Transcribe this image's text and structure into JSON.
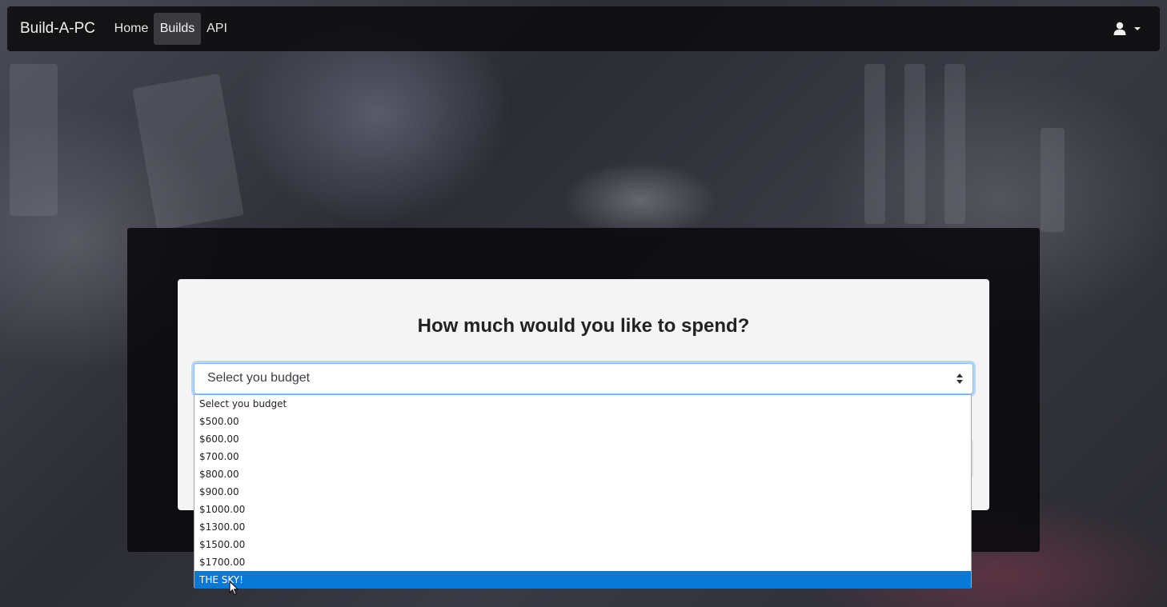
{
  "navbar": {
    "brand": "Build-A-PC",
    "links": [
      {
        "label": "Home",
        "active": false
      },
      {
        "label": "Builds",
        "active": true
      },
      {
        "label": "API",
        "active": false
      }
    ],
    "user_menu_icon": "user-icon"
  },
  "card": {
    "title": "How much would you like to spend?"
  },
  "budget_select": {
    "value": "Select you budget",
    "options": [
      "Select you budget",
      "$500.00",
      "$600.00",
      "$700.00",
      "$800.00",
      "$900.00",
      "$1000.00",
      "$1300.00",
      "$1500.00",
      "$1700.00",
      "THE SKY!"
    ],
    "highlighted_option": "THE SKY!"
  },
  "colors": {
    "highlight": "#0a78d7",
    "navbar": "#0c0c0e",
    "card": "#f4f4f4",
    "focus_border": "#80bdff"
  }
}
